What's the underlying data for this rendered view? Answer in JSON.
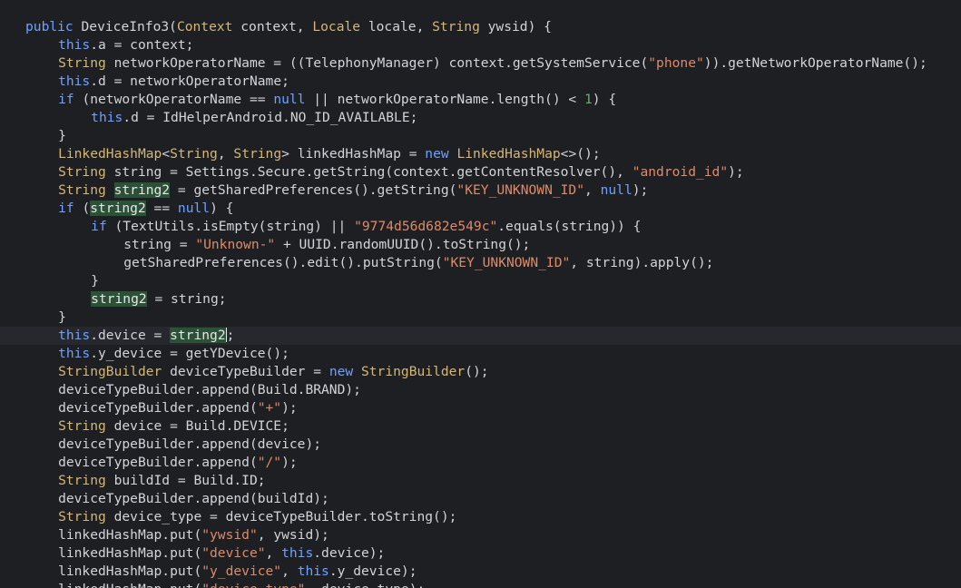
{
  "editor": {
    "language": "java",
    "colors": {
      "background": "#1e1f22",
      "current_line": "#26282e",
      "keyword_blue": "#6fa1ff",
      "type": "#d5b778",
      "string": "#de8b6a",
      "number": "#6aab73",
      "highlight": "#2b5136"
    },
    "caret": {
      "line": 17
    },
    "lines": [
      {
        "indent": "",
        "tokens": [
          {
            "t": "public ",
            "c": "kw2"
          },
          {
            "t": "DeviceInfo3(",
            "c": "plain"
          },
          {
            "t": "Context",
            "c": "type"
          },
          {
            "t": " context, ",
            "c": "plain"
          },
          {
            "t": "Locale",
            "c": "type"
          },
          {
            "t": " locale, ",
            "c": "plain"
          },
          {
            "t": "String",
            "c": "type"
          },
          {
            "t": " ywsid) {",
            "c": "plain"
          }
        ]
      },
      {
        "indent": "    ",
        "tokens": [
          {
            "t": "this",
            "c": "kw2"
          },
          {
            "t": ".a = context;",
            "c": "plain"
          }
        ]
      },
      {
        "indent": "    ",
        "tokens": [
          {
            "t": "String",
            "c": "type"
          },
          {
            "t": " networkOperatorName = ((TelephonyManager) context.getSystemService(",
            "c": "plain"
          },
          {
            "t": "\"phone\"",
            "c": "str"
          },
          {
            "t": ")).getNetworkOperatorName();",
            "c": "plain"
          }
        ]
      },
      {
        "indent": "    ",
        "tokens": [
          {
            "t": "this",
            "c": "kw2"
          },
          {
            "t": ".d = networkOperatorName;",
            "c": "plain"
          }
        ]
      },
      {
        "indent": "    ",
        "tokens": [
          {
            "t": "if",
            "c": "kw2"
          },
          {
            "t": " (networkOperatorName == ",
            "c": "plain"
          },
          {
            "t": "null",
            "c": "kw2"
          },
          {
            "t": " || networkOperatorName.length() < ",
            "c": "plain"
          },
          {
            "t": "1",
            "c": "num"
          },
          {
            "t": ") {",
            "c": "plain"
          }
        ]
      },
      {
        "indent": "        ",
        "tokens": [
          {
            "t": "this",
            "c": "kw2"
          },
          {
            "t": ".d = IdHelperAndroid.NO_ID_AVAILABLE;",
            "c": "plain"
          }
        ]
      },
      {
        "indent": "    ",
        "tokens": [
          {
            "t": "}",
            "c": "plain"
          }
        ]
      },
      {
        "indent": "    ",
        "tokens": [
          {
            "t": "LinkedHashMap",
            "c": "type"
          },
          {
            "t": "<",
            "c": "plain"
          },
          {
            "t": "String",
            "c": "type"
          },
          {
            "t": ", ",
            "c": "plain"
          },
          {
            "t": "String",
            "c": "type"
          },
          {
            "t": "> linkedHashMap = ",
            "c": "plain"
          },
          {
            "t": "new",
            "c": "kw2"
          },
          {
            "t": " ",
            "c": "plain"
          },
          {
            "t": "LinkedHashMap",
            "c": "type"
          },
          {
            "t": "<>();",
            "c": "plain"
          }
        ]
      },
      {
        "indent": "    ",
        "tokens": [
          {
            "t": "String",
            "c": "type"
          },
          {
            "t": " string = Settings.Secure.getString(context.getContentResolver(), ",
            "c": "plain"
          },
          {
            "t": "\"android_id\"",
            "c": "str"
          },
          {
            "t": ");",
            "c": "plain"
          }
        ]
      },
      {
        "indent": "    ",
        "tokens": [
          {
            "t": "String",
            "c": "type"
          },
          {
            "t": " ",
            "c": "plain"
          },
          {
            "t": "string2",
            "c": "hl"
          },
          {
            "t": " = getSharedPreferences().getString(",
            "c": "plain"
          },
          {
            "t": "\"KEY_UNKNOWN_ID\"",
            "c": "str"
          },
          {
            "t": ", ",
            "c": "plain"
          },
          {
            "t": "null",
            "c": "kw2"
          },
          {
            "t": ");",
            "c": "plain"
          }
        ]
      },
      {
        "indent": "    ",
        "tokens": [
          {
            "t": "if",
            "c": "kw2"
          },
          {
            "t": " (",
            "c": "plain"
          },
          {
            "t": "string2",
            "c": "hl"
          },
          {
            "t": " == ",
            "c": "plain"
          },
          {
            "t": "null",
            "c": "kw2"
          },
          {
            "t": ") {",
            "c": "plain"
          }
        ]
      },
      {
        "indent": "        ",
        "tokens": [
          {
            "t": "if",
            "c": "kw2"
          },
          {
            "t": " (TextUtils.isEmpty(string) || ",
            "c": "plain"
          },
          {
            "t": "\"9774d56d682e549c\"",
            "c": "str"
          },
          {
            "t": ".equals(string)) {",
            "c": "plain"
          }
        ]
      },
      {
        "indent": "            ",
        "tokens": [
          {
            "t": "string = ",
            "c": "plain"
          },
          {
            "t": "\"Unknown-\"",
            "c": "str"
          },
          {
            "t": " + UUID.randomUUID().toString();",
            "c": "plain"
          }
        ]
      },
      {
        "indent": "            ",
        "tokens": [
          {
            "t": "getSharedPreferences().edit().putString(",
            "c": "plain"
          },
          {
            "t": "\"KEY_UNKNOWN_ID\"",
            "c": "str"
          },
          {
            "t": ", string).apply();",
            "c": "plain"
          }
        ]
      },
      {
        "indent": "        ",
        "tokens": [
          {
            "t": "}",
            "c": "plain"
          }
        ]
      },
      {
        "indent": "        ",
        "tokens": [
          {
            "t": "string2",
            "c": "hl"
          },
          {
            "t": " = string;",
            "c": "plain"
          }
        ]
      },
      {
        "indent": "    ",
        "tokens": [
          {
            "t": "}",
            "c": "plain"
          }
        ]
      },
      {
        "indent": "    ",
        "tokens": [
          {
            "t": "this",
            "c": "kw2"
          },
          {
            "t": ".device = ",
            "c": "plain"
          },
          {
            "t": "string2",
            "c": "hl"
          },
          {
            "t": ";",
            "c": "plain"
          }
        ]
      },
      {
        "indent": "    ",
        "tokens": [
          {
            "t": "this",
            "c": "kw2"
          },
          {
            "t": ".y_device = getYDevice();",
            "c": "plain"
          }
        ]
      },
      {
        "indent": "    ",
        "tokens": [
          {
            "t": "StringBuilder",
            "c": "type"
          },
          {
            "t": " deviceTypeBuilder = ",
            "c": "plain"
          },
          {
            "t": "new",
            "c": "kw2"
          },
          {
            "t": " ",
            "c": "plain"
          },
          {
            "t": "StringBuilder",
            "c": "type"
          },
          {
            "t": "();",
            "c": "plain"
          }
        ]
      },
      {
        "indent": "    ",
        "tokens": [
          {
            "t": "deviceTypeBuilder.append(Build.BRAND);",
            "c": "plain"
          }
        ]
      },
      {
        "indent": "    ",
        "tokens": [
          {
            "t": "deviceTypeBuilder.append(",
            "c": "plain"
          },
          {
            "t": "\"+\"",
            "c": "str"
          },
          {
            "t": ");",
            "c": "plain"
          }
        ]
      },
      {
        "indent": "    ",
        "tokens": [
          {
            "t": "String",
            "c": "type"
          },
          {
            "t": " device = Build.DEVICE;",
            "c": "plain"
          }
        ]
      },
      {
        "indent": "    ",
        "tokens": [
          {
            "t": "deviceTypeBuilder.append(device);",
            "c": "plain"
          }
        ]
      },
      {
        "indent": "    ",
        "tokens": [
          {
            "t": "deviceTypeBuilder.append(",
            "c": "plain"
          },
          {
            "t": "\"/\"",
            "c": "str"
          },
          {
            "t": ");",
            "c": "plain"
          }
        ]
      },
      {
        "indent": "    ",
        "tokens": [
          {
            "t": "String",
            "c": "type"
          },
          {
            "t": " buildId = Build.ID;",
            "c": "plain"
          }
        ]
      },
      {
        "indent": "    ",
        "tokens": [
          {
            "t": "deviceTypeBuilder.append(buildId);",
            "c": "plain"
          }
        ]
      },
      {
        "indent": "    ",
        "tokens": [
          {
            "t": "String",
            "c": "type"
          },
          {
            "t": " device_type = deviceTypeBuilder.toString();",
            "c": "plain"
          }
        ]
      },
      {
        "indent": "    ",
        "tokens": [
          {
            "t": "linkedHashMap.put(",
            "c": "plain"
          },
          {
            "t": "\"ywsid\"",
            "c": "str"
          },
          {
            "t": ", ywsid);",
            "c": "plain"
          }
        ]
      },
      {
        "indent": "    ",
        "tokens": [
          {
            "t": "linkedHashMap.put(",
            "c": "plain"
          },
          {
            "t": "\"device\"",
            "c": "str"
          },
          {
            "t": ", ",
            "c": "plain"
          },
          {
            "t": "this",
            "c": "kw2"
          },
          {
            "t": ".device);",
            "c": "plain"
          }
        ]
      },
      {
        "indent": "    ",
        "tokens": [
          {
            "t": "linkedHashMap.put(",
            "c": "plain"
          },
          {
            "t": "\"y_device\"",
            "c": "str"
          },
          {
            "t": ", ",
            "c": "plain"
          },
          {
            "t": "this",
            "c": "kw2"
          },
          {
            "t": ".y_device);",
            "c": "plain"
          }
        ]
      },
      {
        "indent": "    ",
        "tokens": [
          {
            "t": "linkedHashMap.put(",
            "c": "plain"
          },
          {
            "t": "\"device_type\"",
            "c": "str"
          },
          {
            "t": ", device_type);",
            "c": "plain"
          }
        ]
      }
    ]
  }
}
